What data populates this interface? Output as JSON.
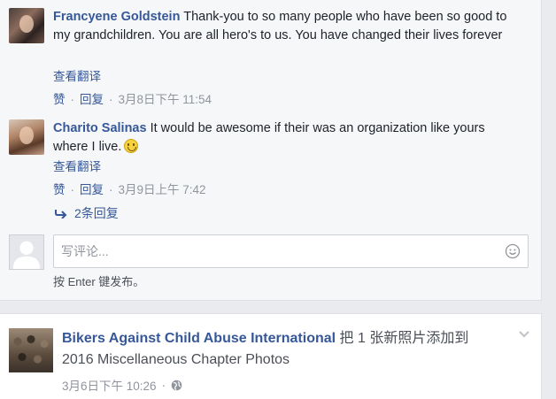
{
  "comments": [
    {
      "author": "Francyene Goldstein",
      "text": "Thank-you to so many people who have been so good to my grandchildren. You are all hero's to us. You have changed their lives forever",
      "translate": "查看翻译",
      "like": "赞",
      "reply": "回复",
      "time": "3月8日下午 11:54"
    },
    {
      "author": "Charito Salinas",
      "text": "It would be awesome if their was an organization like yours where I live.",
      "translate": "查看翻译",
      "like": "赞",
      "reply": "回复",
      "time": "3月9日上午 7:42"
    }
  ],
  "replies_link": "2条回复",
  "composer": {
    "placeholder": "写评论...",
    "hint": "按 Enter 键发布。"
  },
  "post": {
    "page_name": "Bikers Against Child Abuse International",
    "action_text": "把 1 张新照片添加到 2016 Miscellaneous Chapter Photos",
    "time": "3月6日下午 10:26",
    "separator": "·"
  },
  "colors": {
    "link": "#365899",
    "muted": "#90949c",
    "background": "#e9ebee"
  },
  "icons": {
    "reply_arrow": "reply-arrow-icon",
    "emoji": "smiley-icon",
    "globe": "globe-icon",
    "chevron": "chevron-down-icon"
  }
}
